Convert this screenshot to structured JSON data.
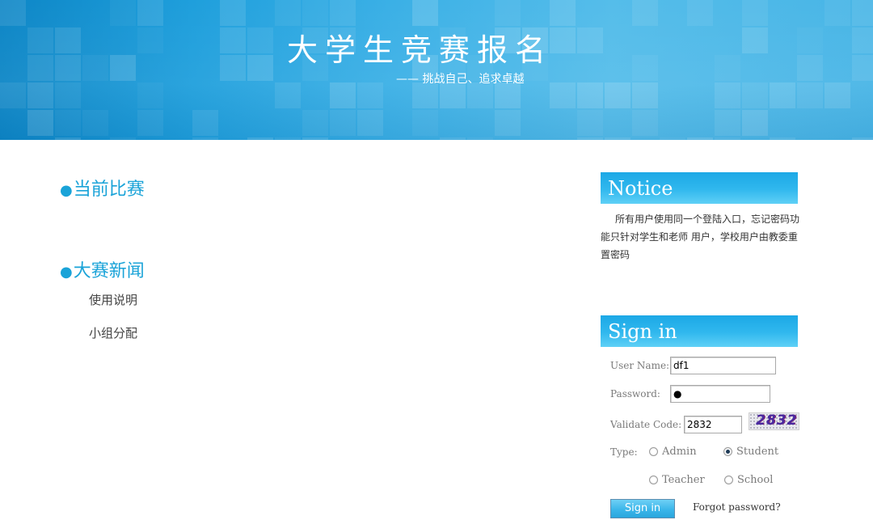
{
  "banner": {
    "title": "大学生竞赛报名",
    "subtitle": "—— 挑战自己、追求卓越"
  },
  "sections": {
    "current": {
      "bullet": "●",
      "title": "当前比赛"
    },
    "news": {
      "bullet": "●",
      "title": "大赛新闻",
      "items": [
        "使用说明",
        "小组分配"
      ]
    }
  },
  "notice": {
    "title": "Notice",
    "text": "所有用户使用同一个登陆入口，忘记密码功能只针对学生和老师 用户，学校用户由教委重置密码"
  },
  "signin": {
    "title": "Sign in",
    "username_label": "User Name:",
    "username_value": "df1",
    "password_label": "Password:",
    "password_value": "●",
    "code_label": "Validate Code:",
    "code_value": "2832",
    "captcha_text": "2832",
    "type_label": "Type:",
    "types": [
      {
        "label": "Admin",
        "checked": false
      },
      {
        "label": "Student",
        "checked": true
      },
      {
        "label": "Teacher",
        "checked": false
      },
      {
        "label": "School",
        "checked": false
      }
    ],
    "submit_label": "Sign in",
    "forgot_label": "Forgot password?"
  },
  "colors": {
    "accent": "#1aa3d8",
    "panel_header": "#31b8ee",
    "banner": "#3bb0e6"
  }
}
